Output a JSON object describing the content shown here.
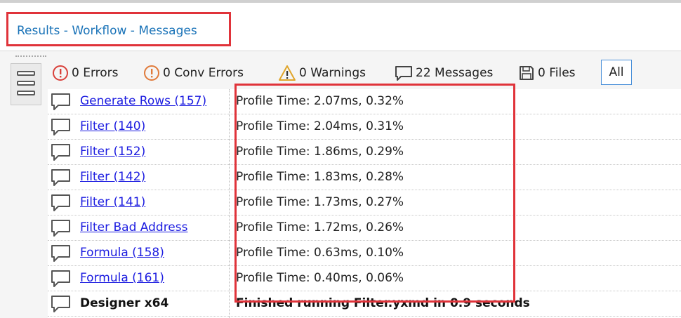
{
  "header": {
    "title": "Results - Workflow - Messages"
  },
  "filters": [
    {
      "label": "0 Errors",
      "icon": "error-circle-icon",
      "color": "#d9403a"
    },
    {
      "label": "0 Conv Errors",
      "icon": "conversion-error-icon",
      "color": "#e07a3a"
    },
    {
      "label": "0 Warnings",
      "icon": "warning-triangle-icon",
      "color": "#e0a52a"
    },
    {
      "label": "22 Messages",
      "icon": "message-icon",
      "color": "#333333"
    },
    {
      "label": "0 Files",
      "icon": "file-save-icon",
      "color": "#333333"
    }
  ],
  "all_button": "All",
  "rows": [
    {
      "tool": "Generate Rows (157)",
      "message": "Profile Time: 2.07ms, 0.32%"
    },
    {
      "tool": "Filter (140)",
      "message": "Profile Time: 2.04ms, 0.31%"
    },
    {
      "tool": "Filter (152)",
      "message": "Profile Time: 1.86ms, 0.29%"
    },
    {
      "tool": "Filter (142)",
      "message": "Profile Time: 1.83ms, 0.28%"
    },
    {
      "tool": "Filter (141)",
      "message": "Profile Time: 1.73ms, 0.27%"
    },
    {
      "tool": "Filter Bad Address",
      "message": "Profile Time: 1.72ms, 0.26%"
    },
    {
      "tool": "Formula (158)",
      "message": "Profile Time: 0.63ms, 0.10%"
    },
    {
      "tool": "Formula (161)",
      "message": "Profile Time: 0.40ms, 0.06%"
    },
    {
      "tool": "Designer x64",
      "message": "Finished running Filter.yxmd in 0.9 seconds"
    }
  ],
  "colors": {
    "highlight": "#e0333a",
    "title": "#1a73b8",
    "link": "#1c1ce0"
  }
}
